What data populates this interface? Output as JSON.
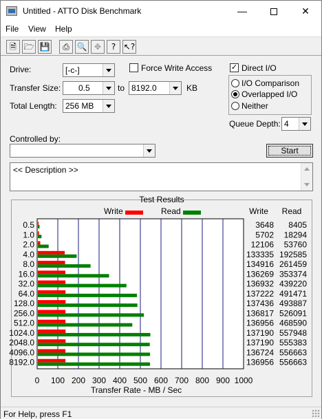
{
  "window": {
    "title": "Untitled - ATTO Disk Benchmark"
  },
  "menu": [
    "File",
    "View",
    "Help"
  ],
  "toolbar_icons": [
    "new-file-icon",
    "open-folder-icon",
    "save-icon",
    "print-icon",
    "print-preview-icon",
    "move-icon",
    "help-icon",
    "context-help-icon"
  ],
  "settings": {
    "drive_label": "Drive:",
    "drive_value": "[-c-]",
    "transfer_size_label": "Transfer Size:",
    "transfer_from": "0.5",
    "to_label": "to",
    "transfer_to": "8192.0",
    "kb_label": "KB",
    "total_length_label": "Total Length:",
    "total_length_value": "256 MB",
    "force_write_label": "Force Write Access",
    "direct_io_label": "Direct I/O",
    "io_comparison_label": "I/O Comparison",
    "overlapped_io_label": "Overlapped I/O",
    "neither_label": "Neither",
    "queue_depth_label": "Queue Depth:",
    "queue_depth_value": "4",
    "controlled_by_label": "Controlled by:",
    "controlled_by_value": "",
    "start_label": "Start",
    "description_text": "<< Description >>"
  },
  "statusbar": {
    "text": "For Help, press F1"
  },
  "chart_data": {
    "type": "bar",
    "title": "Test Results",
    "legend": [
      "Write",
      "Read"
    ],
    "xlabel": "Transfer Rate - MB / Sec",
    "xlim": [
      0,
      1000
    ],
    "xticks": [
      "0",
      "100",
      "200",
      "300",
      "400",
      "500",
      "600",
      "700",
      "800",
      "900",
      "1000"
    ],
    "categories": [
      "0.5",
      "1.0",
      "2.0",
      "4.0",
      "8.0",
      "16.0",
      "32.0",
      "64.0",
      "128.0",
      "256.0",
      "512.0",
      "1024.0",
      "2048.0",
      "4096.0",
      "8192.0"
    ],
    "series": [
      {
        "name": "Write",
        "color": "#ff0000",
        "values": [
          3.56,
          5.57,
          11.8,
          130.2,
          131.8,
          133.1,
          133.7,
          134.0,
          134.2,
          133.6,
          133.7,
          134.2,
          134.2,
          133.5,
          133.7
        ]
      },
      {
        "name": "Read",
        "color": "#008000",
        "values": [
          8.21,
          17.8,
          52.5,
          188.1,
          255.3,
          345.1,
          429.2,
          480.0,
          482.3,
          513.8,
          457.6,
          544.9,
          542.4,
          543.6,
          543.6
        ]
      }
    ],
    "table_headers": [
      "Write",
      "Read"
    ],
    "table_rows": [
      [
        "3648",
        "8405"
      ],
      [
        "5702",
        "18294"
      ],
      [
        "12106",
        "53760"
      ],
      [
        "133335",
        "192585"
      ],
      [
        "134916",
        "261459"
      ],
      [
        "136269",
        "353374"
      ],
      [
        "136932",
        "439220"
      ],
      [
        "137222",
        "491471"
      ],
      [
        "137436",
        "493887"
      ],
      [
        "136817",
        "526091"
      ],
      [
        "136956",
        "468590"
      ],
      [
        "137190",
        "557948"
      ],
      [
        "137190",
        "555383"
      ],
      [
        "136724",
        "556663"
      ],
      [
        "136956",
        "556663"
      ]
    ],
    "grid": true,
    "legend_position": "top"
  }
}
